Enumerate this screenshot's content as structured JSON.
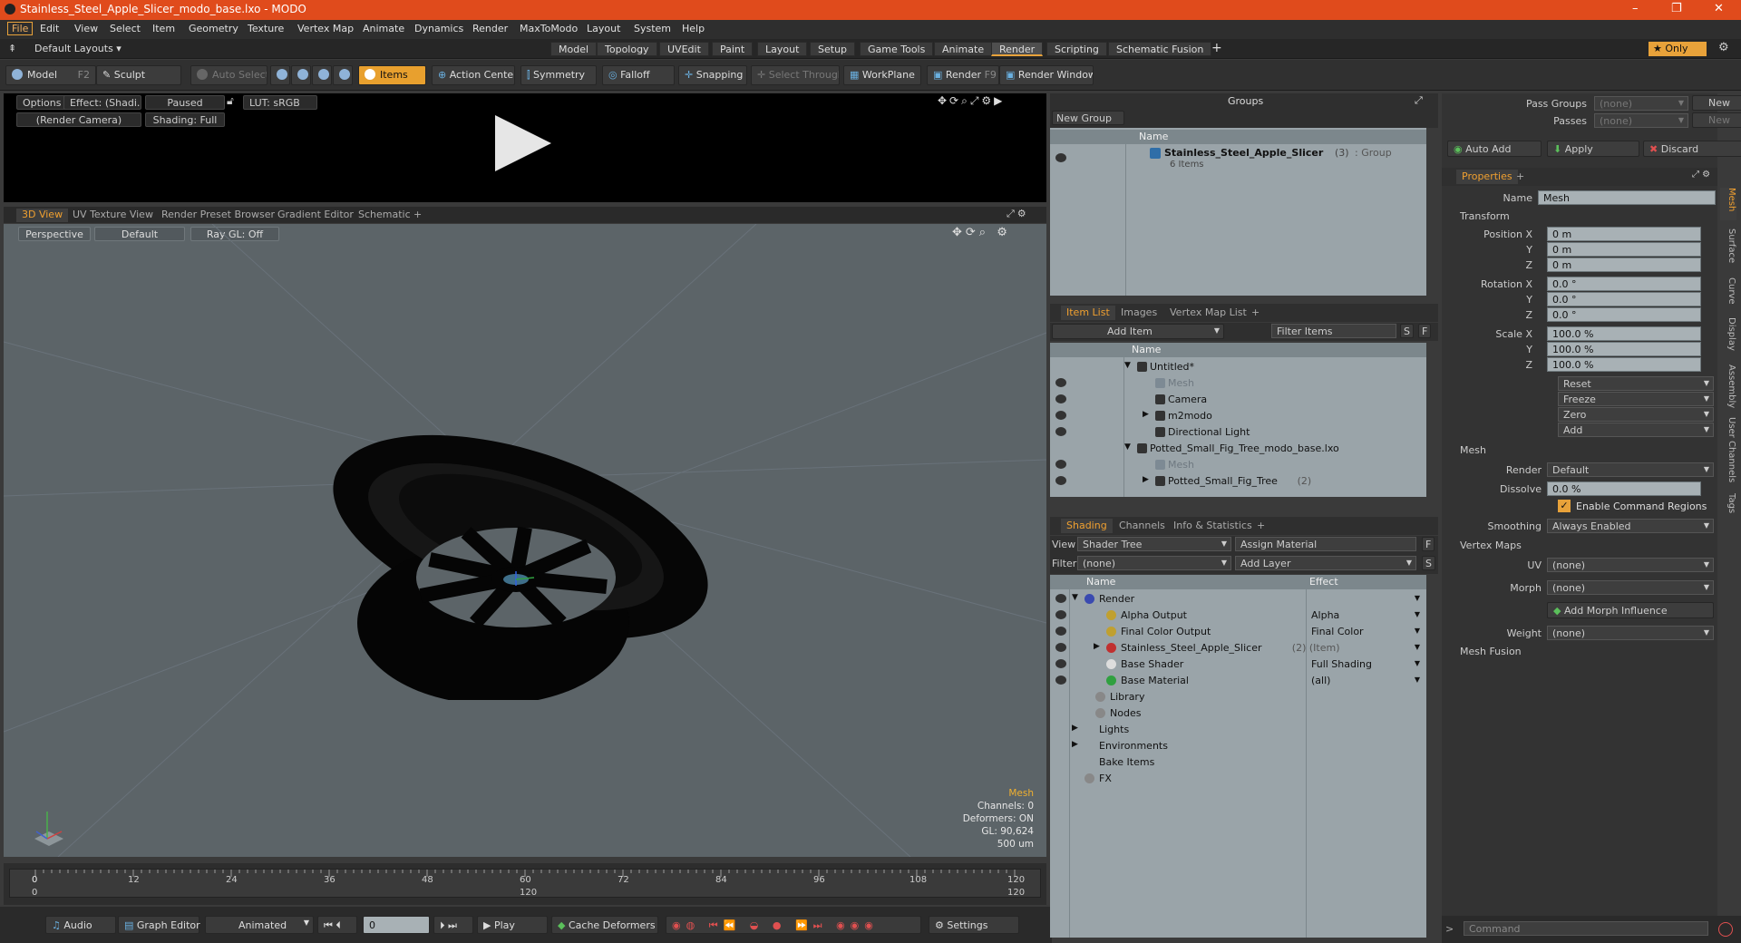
{
  "window": {
    "title": "Stainless_Steel_Apple_Slicer_modo_base.lxo - MODO",
    "controls": [
      "–",
      "❐",
      "✕"
    ]
  },
  "menu": [
    "File",
    "Edit",
    "View",
    "Select",
    "Item",
    "Geometry",
    "Texture",
    "Vertex Map",
    "Animate",
    "Dynamics",
    "Render",
    "MaxToModo",
    "Layout",
    "System",
    "Help"
  ],
  "layouts": {
    "selector": "Default Layouts ▾",
    "tabs": [
      "Model",
      "Topology",
      "UVEdit",
      "Paint",
      "Layout",
      "Setup",
      "Game Tools",
      "Animate",
      "Render",
      "Scripting",
      "Schematic Fusion"
    ],
    "active": "Render",
    "add": "+",
    "only": "★ Only"
  },
  "toolbar": {
    "model": "Model",
    "model_key": "F2",
    "sculpt": "Sculpt",
    "auto_select": "Auto Select",
    "items": "Items",
    "action_center": "Action Center",
    "symmetry": "Symmetry",
    "falloff": "Falloff",
    "snapping": "Snapping",
    "select_through": "Select Through",
    "workplane": "WorkPlane",
    "render": "Render",
    "render_key": "F9",
    "render_window": "Render Window"
  },
  "preview": {
    "options": "Options",
    "effect": "Effect: (Shadi...",
    "paused": "Paused",
    "lut": "LUT: sRGB",
    "camera": "(Render Camera)",
    "shading": "Shading: Full"
  },
  "viewport_tabs": [
    "3D View",
    "UV Texture View",
    "Render Preset Browser",
    "Gradient Editor",
    "Schematic",
    "+"
  ],
  "viewport": {
    "perspective": "Perspective",
    "default": "Default",
    "raygl": "Ray GL: Off",
    "stats": {
      "label": "Mesh",
      "channels": "Channels: 0",
      "deformers": "Deformers: ON",
      "gl": "GL: 90,624",
      "units": "500 um"
    }
  },
  "timeline": {
    "ticks": [
      "0",
      "12",
      "24",
      "36",
      "48",
      "60",
      "72",
      "84",
      "96",
      "108",
      "120"
    ],
    "sub_ticks": [
      "0",
      "120",
      "120"
    ]
  },
  "bottom": {
    "audio": "Audio",
    "graph_editor": "Graph Editor",
    "animated": "Animated",
    "frame": "0",
    "play": "Play",
    "cache": "Cache Deformers",
    "settings": "Settings"
  },
  "groups": {
    "title": "Groups",
    "new_group": "New Group",
    "col_name": "Name",
    "item_name": "Stainless_Steel_Apple_Slicer",
    "item_count": "(3)",
    "item_type": ": Group",
    "item_sub": "6 Items"
  },
  "itemlist": {
    "tabs": [
      "Item List",
      "Images",
      "Vertex Map List",
      "+"
    ],
    "add_item": "Add Item",
    "filter": "Filter Items",
    "col_name": "Name",
    "rows": [
      {
        "label": "Untitled*",
        "indent": 0,
        "arrow": "▼"
      },
      {
        "label": "Mesh",
        "indent": 2,
        "dim": true
      },
      {
        "label": "Camera",
        "indent": 2
      },
      {
        "label": "m2modo",
        "indent": 2,
        "arrow": "▶"
      },
      {
        "label": "Directional Light",
        "indent": 2
      },
      {
        "label": "Potted_Small_Fig_Tree_modo_base.lxo",
        "indent": 0,
        "arrow": "▼"
      },
      {
        "label": "Mesh",
        "indent": 2,
        "dim": true
      },
      {
        "label": "Potted_Small_Fig_Tree",
        "indent": 2,
        "arrow": "▶",
        "extra": "(2)"
      }
    ]
  },
  "shading": {
    "tabs": [
      "Shading",
      "Channels",
      "Info & Statistics",
      "+"
    ],
    "view_label": "View",
    "view_value": "Shader Tree",
    "assign": "Assign Material",
    "filter_label": "Filter",
    "filter_value": "(none)",
    "add_layer": "Add Layer",
    "col_name": "Name",
    "col_effect": "Effect",
    "rows": [
      {
        "label": "Render",
        "effect": "",
        "indent": 1,
        "arrow": "▼"
      },
      {
        "label": "Alpha Output",
        "effect": "Alpha",
        "indent": 3
      },
      {
        "label": "Final Color Output",
        "effect": "Final Color",
        "indent": 3
      },
      {
        "label": "Stainless_Steel_Apple_Slicer",
        "extra": "(2) (Item)",
        "effect": "",
        "indent": 3,
        "arrow": "▶"
      },
      {
        "label": "Base Shader",
        "effect": "Full Shading",
        "indent": 3
      },
      {
        "label": "Base Material",
        "effect": "(all)",
        "indent": 3
      },
      {
        "label": "Library",
        "effect": "",
        "indent": 2
      },
      {
        "label": "Nodes",
        "effect": "",
        "indent": 2
      },
      {
        "label": "Lights",
        "effect": "",
        "indent": 1,
        "arrow": "▶"
      },
      {
        "label": "Environments",
        "effect": "",
        "indent": 1,
        "arrow": "▶"
      },
      {
        "label": "Bake Items",
        "effect": "",
        "indent": 1
      },
      {
        "label": "FX",
        "effect": "",
        "indent": 1
      }
    ]
  },
  "props": {
    "pass_groups": "Pass Groups",
    "passes": "Passes",
    "none": "(none)",
    "new": "New",
    "auto_add": "Auto Add",
    "apply": "Apply",
    "discard": "Discard",
    "tab": "Properties",
    "name_label": "Name",
    "name_value": "Mesh",
    "transform": "Transform",
    "position": [
      "0 m",
      "0 m",
      "0 m"
    ],
    "rotation": [
      "0.0 °",
      "0.0 °",
      "0.0 °"
    ],
    "scale": [
      "100.0 %",
      "100.0 %",
      "100.0 %"
    ],
    "pos_label": "Position X",
    "rot_label": "Rotation X",
    "scale_label": "Scale X",
    "y": "Y",
    "z": "Z",
    "actions": [
      "Reset",
      "Freeze",
      "Zero",
      "Add"
    ],
    "mesh": "Mesh",
    "render_label": "Render",
    "render_value": "Default",
    "dissolve_label": "Dissolve",
    "dissolve_value": "0.0 %",
    "enable_regions": "Enable Command Regions",
    "smoothing_label": "Smoothing",
    "smoothing_value": "Always Enabled",
    "vertex_maps": "Vertex Maps",
    "uv_label": "UV",
    "morph_label": "Morph",
    "add_morph": "Add Morph Influence",
    "weight_label": "Weight",
    "mesh_fusion": "Mesh Fusion",
    "command": "Command",
    "side_tabs": [
      "Mesh",
      "Surface",
      "Curve",
      "Display",
      "Assembly",
      "User Channels",
      "Tags"
    ]
  },
  "colors": {
    "title": "#e04b1c",
    "accent": "#e8a23a",
    "panel": "#9aa4a9",
    "viewport": "#5c6468"
  }
}
